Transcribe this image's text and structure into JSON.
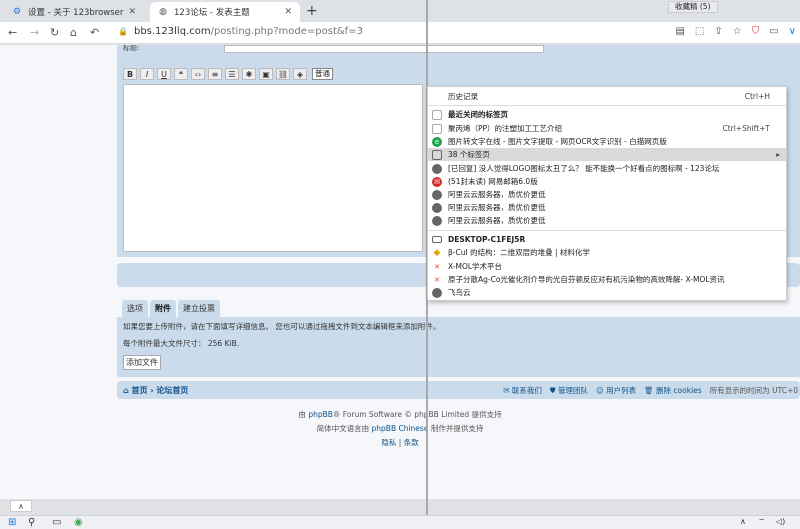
{
  "tabs": [
    {
      "label": "设置 - 关于 123browser",
      "icon": "gear-icon"
    },
    {
      "label": "123论坛 - 发表主题",
      "icon": "globe-icon"
    }
  ],
  "bookmarks_button": "收藏精 (5)",
  "address": {
    "host": "bbs.123llq.com",
    "path": "/posting.php?mode=post&f=3"
  },
  "editor": {
    "subject_label": "标题:",
    "font_select": "普通"
  },
  "post_tabs": [
    "选项",
    "附件",
    "建立投票"
  ],
  "attach": {
    "help": "如果您要上传附件，请在下面填写详细信息。 您也可以通过拖拽文件到文本编辑框来添加附件。",
    "maxsize": "每个附件最大文件尺寸：  256 KiB.",
    "add_button": "添加文件"
  },
  "footer_nav": {
    "home": "首页",
    "forum": "论坛首页",
    "links": [
      "联系我们",
      "管理团队",
      "用户列表",
      "删除 cookies"
    ],
    "tz": "所有显示的时间为 UTC+0"
  },
  "copyright": {
    "line1_pre": "由 ",
    "line1_link": "phpBB",
    "line1_post": "® Forum Software © phpBB Limited 提供支持",
    "line2_pre": "简体中文语言由 ",
    "line2_link": "phpBB Chinese",
    "line2_post": " 制作并提供支持",
    "privacy": "隐私",
    "terms": "条款"
  },
  "menu": {
    "history": {
      "label": "历史记录",
      "shortcut": "Ctrl+H"
    },
    "recent_header": "最近关闭的标签页",
    "items": [
      {
        "label": "聚丙烯（PP）的注塑加工工艺介绍",
        "shortcut": "Ctrl+Shift+T",
        "icon": "page-icon",
        "color": "#ffffff"
      },
      {
        "label": "图片转文字在线 - 图片文字提取 - 网页OCR文字识别 - 白描网页版",
        "shortcut": "",
        "icon": "ocr-icon",
        "color": "#1aa34a"
      },
      {
        "label": "38 个标签页",
        "shortcut": "",
        "icon": "window-icon",
        "color": "#ffffff"
      },
      {
        "label": "[已回复] 没人觉得LOGO图标太丑了么？ 能不能换一个好看点的图标啊 - 123论坛",
        "shortcut": "",
        "icon": "globe-icon",
        "color": "#666666"
      },
      {
        "label": "(51封未读) 网易邮箱6.0版",
        "shortcut": "",
        "icon": "mail-icon",
        "color": "#d02b2b"
      },
      {
        "label": "阿里云云服务器，质优价更低",
        "shortcut": "",
        "icon": "globe-icon",
        "color": "#666666"
      },
      {
        "label": "阿里云云服务器，质优价更低",
        "shortcut": "",
        "icon": "globe-icon",
        "color": "#666666"
      },
      {
        "label": "阿里云云服务器，质优价更低",
        "shortcut": "",
        "icon": "globe-icon",
        "color": "#666666"
      }
    ],
    "device": "DESKTOP-C1FEJ5R",
    "device_items": [
      {
        "label": "β-CuI 的结构：二维双层的堆叠 | 材料化学",
        "icon": "diamond-icon",
        "color": "#e2a400"
      },
      {
        "label": "X-MOL学术平台",
        "icon": "xmol-icon",
        "color": "#e34a2b"
      },
      {
        "label": "原子分散Ag-Co光催化剂介导的光自芬顿反应对有机污染物的高效降解- X-MOL资讯",
        "icon": "xmol-icon",
        "color": "#e34a2b"
      },
      {
        "label": "飞鸟云",
        "icon": "globe-icon",
        "color": "#666666"
      }
    ]
  }
}
